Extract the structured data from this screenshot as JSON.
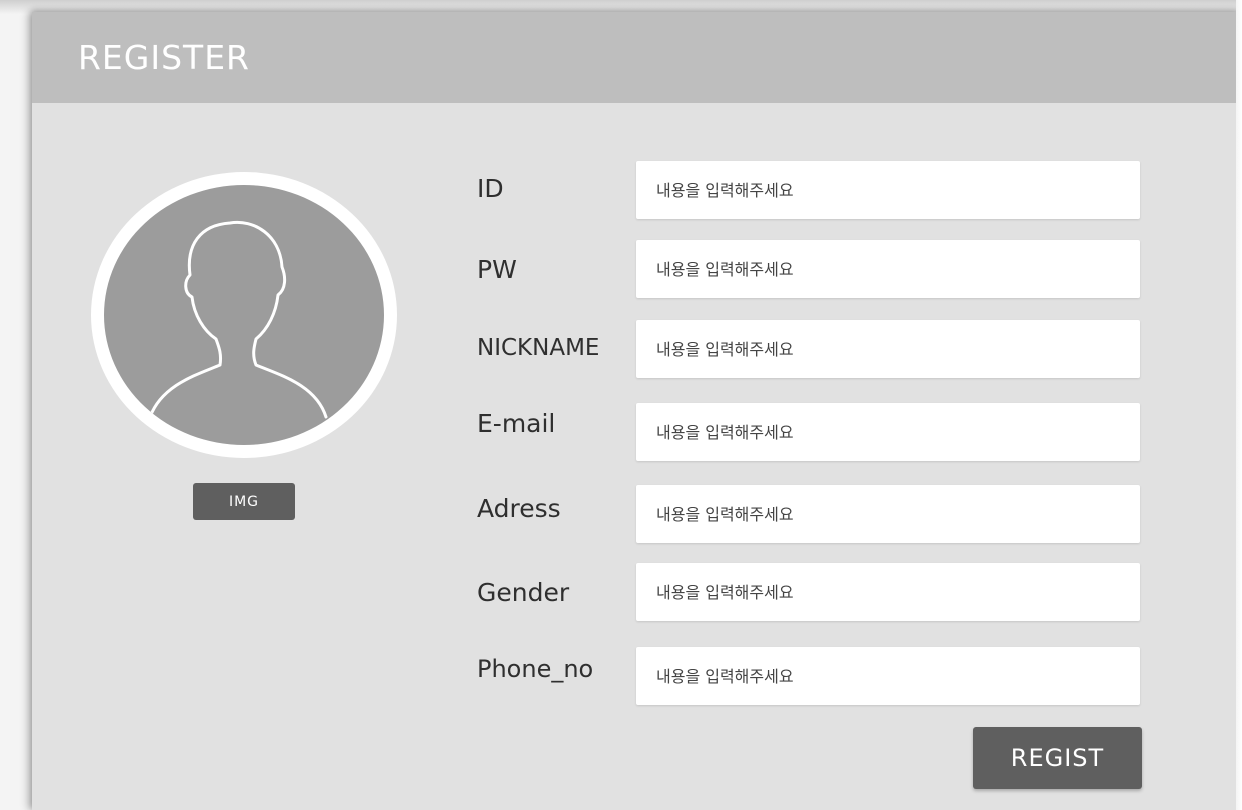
{
  "header": {
    "title": "REGISTER"
  },
  "avatar": {
    "icon": "user-silhouette-icon",
    "button_label": "IMG"
  },
  "fields": [
    {
      "label": "ID",
      "placeholder": "내용을 입력해주세요",
      "value": ""
    },
    {
      "label": "PW",
      "placeholder": "내용을 입력해주세요",
      "value": ""
    },
    {
      "label": "NICKNAME",
      "placeholder": "내용을 입력해주세요",
      "value": ""
    },
    {
      "label": "E-mail",
      "placeholder": "내용을 입력해주세요",
      "value": ""
    },
    {
      "label": "Adress",
      "placeholder": "내용을 입력해주세요",
      "value": ""
    },
    {
      "label": "Gender",
      "placeholder": "내용을 입력해주세요",
      "value": ""
    },
    {
      "label": "Phone_no",
      "placeholder": "내용을 입력해주세요",
      "value": ""
    }
  ],
  "actions": {
    "submit_label": "REGIST"
  },
  "colors": {
    "header_bg": "#bebebe",
    "panel_bg": "#e1e1e1",
    "button_bg": "#5f5f5f",
    "avatar_bg": "#9c9c9c"
  }
}
